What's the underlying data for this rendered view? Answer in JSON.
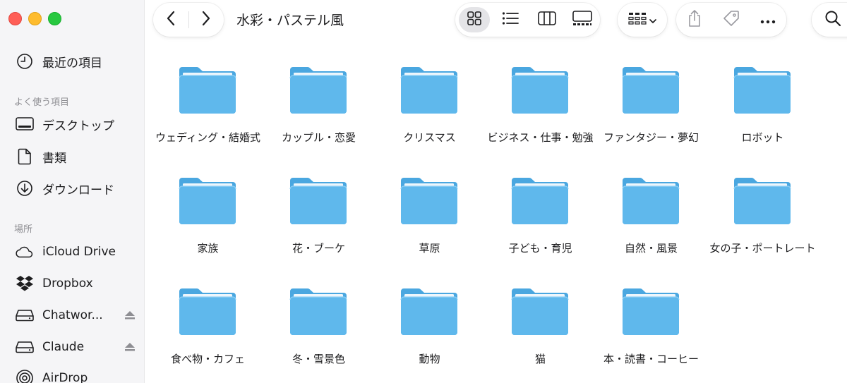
{
  "window": {
    "title": "水彩・パステル風"
  },
  "colors": {
    "folder_front": "#5fb8ec",
    "folder_back": "#4aa7e0",
    "accent": "#007aff"
  },
  "sidebar": {
    "recents": {
      "label": "最近の項目",
      "icon": "clock-icon"
    },
    "favorites_header": "よく使う項目",
    "favorites": [
      {
        "label": "デスクトップ",
        "icon": "desktop-icon"
      },
      {
        "label": "書類",
        "icon": "document-icon"
      },
      {
        "label": "ダウンロード",
        "icon": "download-icon"
      }
    ],
    "locations_header": "場所",
    "locations": [
      {
        "label": "iCloud Drive",
        "icon": "cloud-icon"
      },
      {
        "label": "Dropbox",
        "icon": "dropbox-icon"
      },
      {
        "label": "Chatwor...",
        "icon": "drive-icon",
        "eject": true
      },
      {
        "label": "Claude",
        "icon": "drive-icon",
        "eject": true
      },
      {
        "label": "AirDrop",
        "icon": "airdrop-icon"
      }
    ]
  },
  "toolbar": {
    "view_modes": [
      "icon-view-icon",
      "list-view-icon",
      "column-view-icon",
      "gallery-view-icon"
    ],
    "active_view": "icon-view-icon"
  },
  "folders": [
    {
      "name": "ウェディング・結婚式"
    },
    {
      "name": "カップル・恋愛"
    },
    {
      "name": "クリスマス"
    },
    {
      "name": "ビジネス・仕事・勉強"
    },
    {
      "name": "ファンタジー・夢幻"
    },
    {
      "name": "ロボット"
    },
    {
      "name": "家族"
    },
    {
      "name": "花・ブーケ"
    },
    {
      "name": "草原"
    },
    {
      "name": "子ども・育児"
    },
    {
      "name": "自然・風景"
    },
    {
      "name": "女の子・ポートレート"
    },
    {
      "name": "食べ物・カフェ"
    },
    {
      "name": "冬・雪景色"
    },
    {
      "name": "動物"
    },
    {
      "name": "猫"
    },
    {
      "name": "本・読書・コーヒー"
    }
  ]
}
